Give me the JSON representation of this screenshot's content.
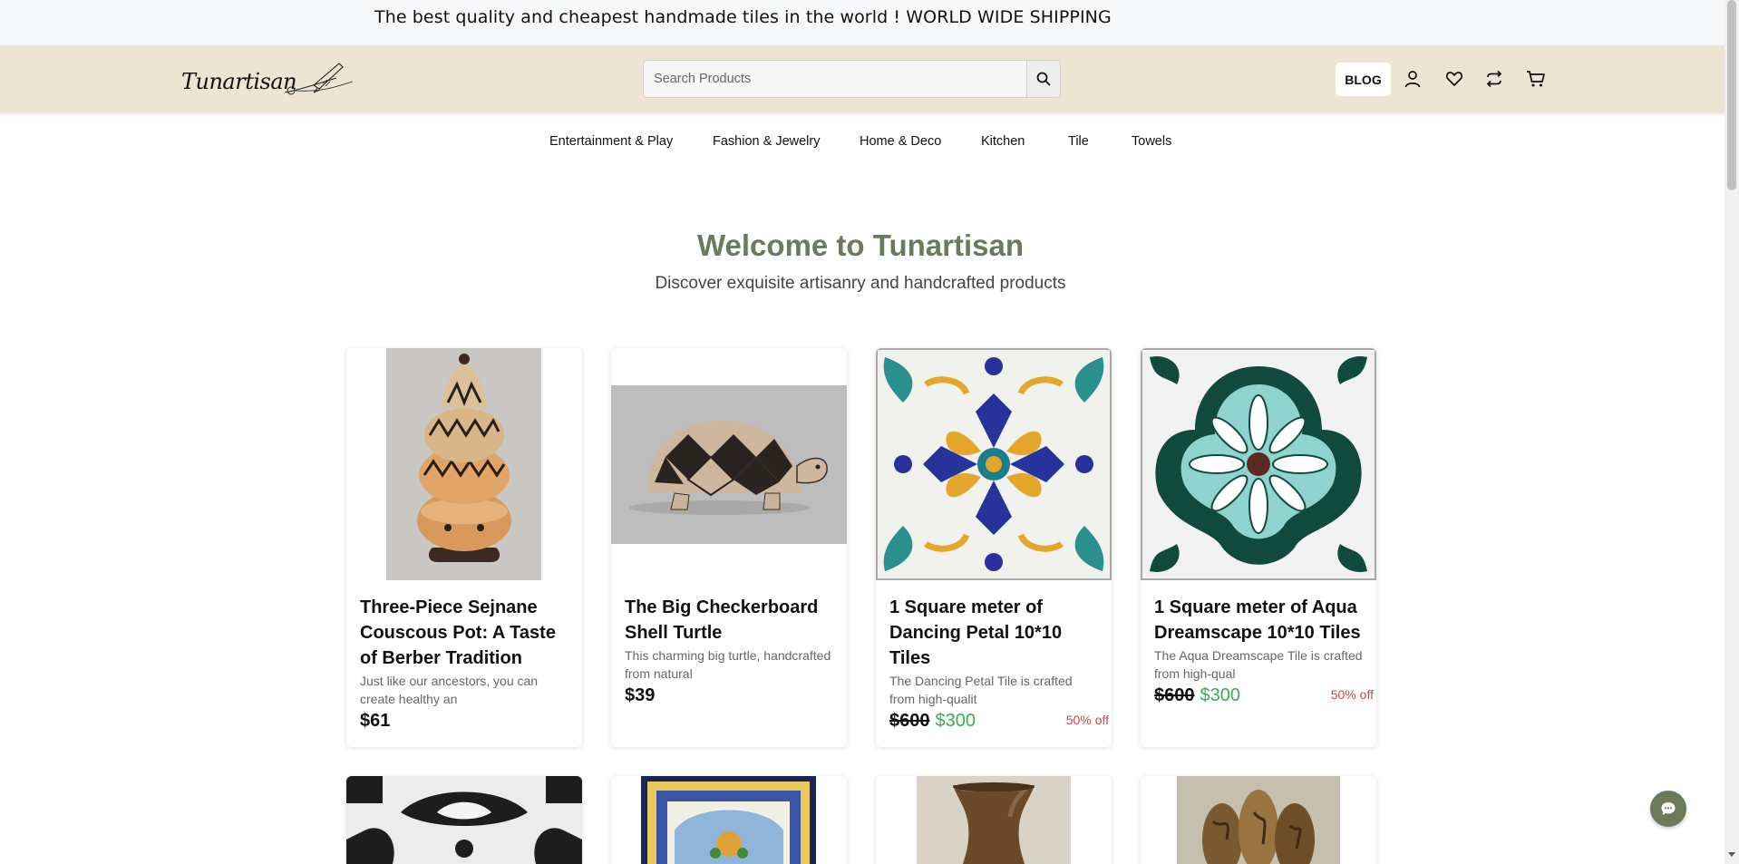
{
  "announcement": {
    "text": "The best quality and cheapest handmade tiles in the world ! WORLD WIDE SHIPPING"
  },
  "header": {
    "logo_text": "Tunartisan",
    "search_placeholder": "Search Products",
    "search_value": "",
    "blog_label": "BLOG",
    "icons": [
      "user-icon",
      "heart-icon",
      "compare-icon",
      "cart-icon"
    ]
  },
  "categories": [
    {
      "label": "Entertainment & Play"
    },
    {
      "label": "Fashion & Jewelry"
    },
    {
      "label": "Home & Deco"
    },
    {
      "label": "Kitchen"
    },
    {
      "label": "Tile"
    },
    {
      "label": "Towels"
    }
  ],
  "hero": {
    "title": "Welcome to Tunartisan",
    "subtitle": "Discover exquisite artisanry and handcrafted products"
  },
  "products": [
    {
      "title": "Three-Piece Sejnane Couscous Pot: A Taste of Berber Tradition",
      "desc": "Just like our ancestors, you can create healthy an",
      "price": "$61",
      "old_price": "",
      "new_price": "",
      "discount": ""
    },
    {
      "title": "The Big Checkerboard Shell Turtle",
      "desc": "This charming big turtle, handcrafted from natural",
      "price": "$39",
      "old_price": "",
      "new_price": "",
      "discount": ""
    },
    {
      "title": "1 Square meter of Dancing Petal 10*10 Tiles",
      "desc": "The Dancing Petal Tile is crafted from high-qualit",
      "price": "",
      "old_price": "$600",
      "new_price": "$300",
      "discount": "50% off"
    },
    {
      "title": "1 Square meter of Aqua Dreamscape 10*10 Tiles",
      "desc": "The Aqua Dreamscape Tile is crafted from high-qual",
      "price": "",
      "old_price": "$600",
      "new_price": "$300",
      "discount": "50% off"
    }
  ],
  "colors": {
    "header_bg": "#ede4d3",
    "accent_green": "#6b7a5a",
    "sale_green": "#3aaa55",
    "discount_red": "#d04545"
  }
}
